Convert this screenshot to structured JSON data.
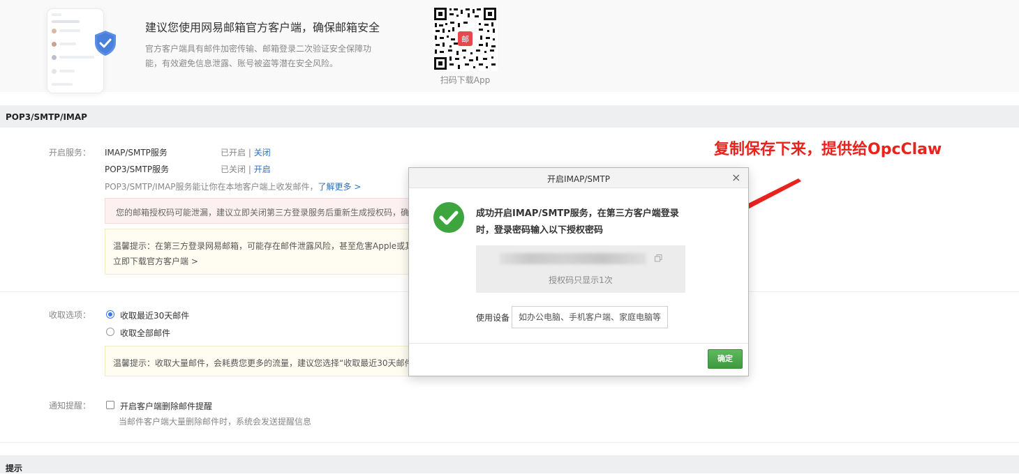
{
  "banner": {
    "title": "建议您使用网易邮箱官方客户端，确保邮箱安全",
    "desc": "官方客户端具有邮件加密传输、邮箱登录二次验证安全保障功能，有效避免信息泄露、账号被盗等潜在安全风险。",
    "qr_caption": "扫码下载App",
    "qr_logo_text": "邮"
  },
  "section": {
    "title": "POP3/SMTP/IMAP",
    "tips_title": "提示"
  },
  "services": {
    "label": "开启服务：",
    "items": [
      {
        "name": "IMAP/SMTP服务",
        "status": "已开启",
        "sep": "|",
        "action": "关闭"
      },
      {
        "name": "POP3/SMTP服务",
        "status": "已关闭",
        "sep": "|",
        "action": "开启"
      }
    ],
    "desc": "POP3/SMTP/IMAP服务能让你在本地客户端上收发邮件，",
    "learn_more": "了解更多 >",
    "alert": "您的邮箱授权码可能泄漏，建议立即关闭第三方登录服务后重新生成授权码，确",
    "tip_line1": "温馨提示：在第三方登录网易邮箱，可能存在邮件泄露风险，甚至危害Apple或其",
    "tip_link": "立即下载官方客户端 >"
  },
  "receive": {
    "label": "收取选项：",
    "opt1": "收取最近30天邮件",
    "opt2": "收取全部邮件",
    "tip": "温馨提示：收取大量邮件，会耗费您更多的流量，建议您选择“收取最近30天邮件”"
  },
  "notify": {
    "label": "通知提醒：",
    "checkbox": "开启客户端删除邮件提醒",
    "desc": "当邮件客户端大量删除邮件时，系统会发送提醒信息"
  },
  "annotation": {
    "text": "复制保存下来，提供给OpcClaw",
    "color": "#e8231d"
  },
  "dialog": {
    "title": "开启IMAP/SMTP",
    "close": "×",
    "message": "成功开启IMAP/SMTP服务，在第三方客户端登录时，登录密码输入以下授权密码",
    "code_note": "授权码只显示1次",
    "device_label": "使用设备",
    "device_placeholder": "如办公电脑、手机客户端、家庭电脑等",
    "ok": "确定"
  },
  "icons": [
    "shield-check-icon",
    "qr-code-icon",
    "success-check-icon",
    "copy-icon",
    "close-icon",
    "red-arrow-icon"
  ],
  "colors": {
    "link": "#2f6fc5",
    "success": "#3da53d",
    "ok_button": "#4aa84a",
    "annotation": "#e8231d"
  }
}
